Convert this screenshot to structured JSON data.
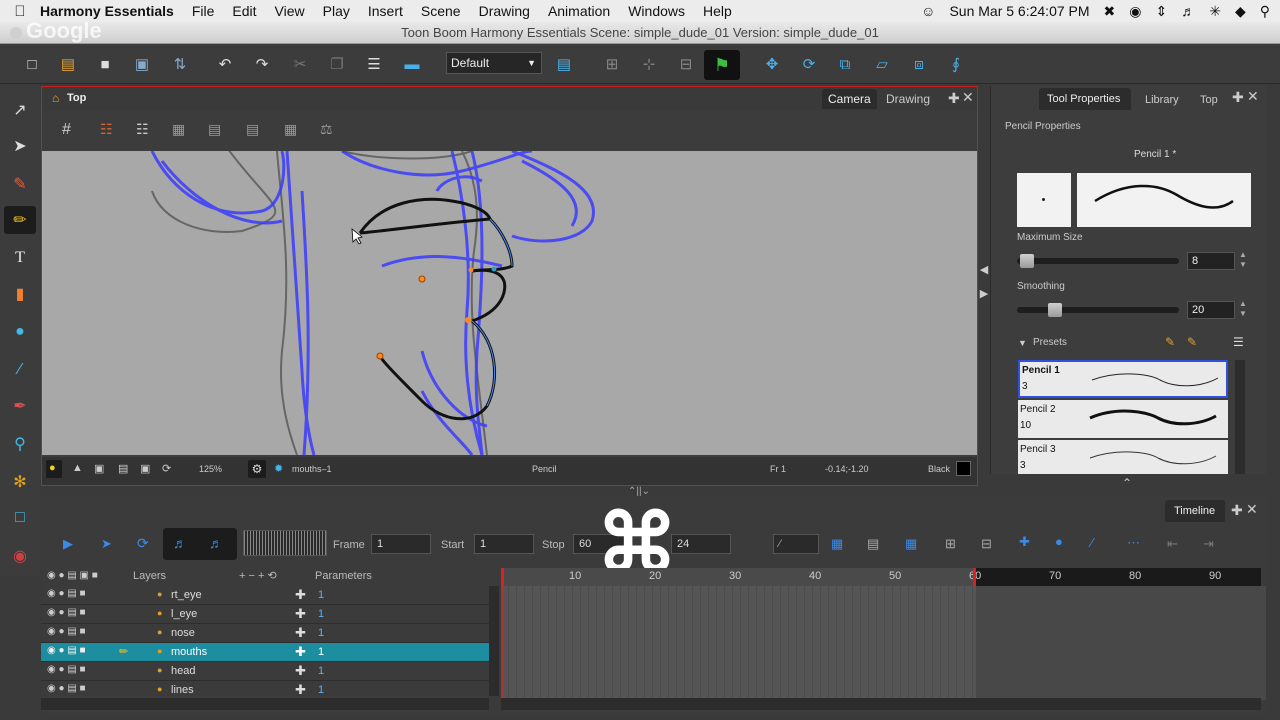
{
  "menubar": {
    "app": "Harmony Essentials",
    "items": [
      "File",
      "Edit",
      "View",
      "Play",
      "Insert",
      "Scene",
      "Drawing",
      "Animation",
      "Windows",
      "Help"
    ],
    "clock": "Sun Mar 5  6:24:07 PM"
  },
  "window": {
    "title": "Toon Boom Harmony Essentials Scene: simple_dude_01 Version: simple_dude_01",
    "overlay_logo": "Google"
  },
  "toolbar": {
    "workspace": "Default"
  },
  "camera_view": {
    "title": "Top",
    "tabs": [
      "Camera",
      "Drawing"
    ],
    "status": {
      "zoom": "125%",
      "layer": "mouths–1",
      "tool": "Pencil",
      "frame": "Fr 1",
      "coords": "-0.14;-1.20",
      "color_name": "Black"
    }
  },
  "tool_properties": {
    "tabs": [
      "Tool Properties",
      "Library",
      "Top"
    ],
    "section": "Pencil Properties",
    "preset_name": "Pencil 1 *",
    "max_size_label": "Maximum Size",
    "max_size_value": "8",
    "smoothing_label": "Smoothing",
    "smoothing_value": "20",
    "presets_label": "Presets",
    "presets": [
      {
        "name": "Pencil 1",
        "size": "3"
      },
      {
        "name": "Pencil 2",
        "size": "10"
      },
      {
        "name": "Pencil 3",
        "size": "3"
      }
    ]
  },
  "timeline": {
    "title": "Timeline",
    "frame_label": "Frame",
    "frame_value": "1",
    "start_label": "Start",
    "start_value": "1",
    "stop_label": "Stop",
    "stop_value": "60",
    "fps_value": "24",
    "layers_header": "Layers",
    "params_header": "Parameters",
    "layers": [
      {
        "name": "rt_eye",
        "value": "1"
      },
      {
        "name": "l_eye",
        "value": "1"
      },
      {
        "name": "nose",
        "value": "1"
      },
      {
        "name": "mouths",
        "value": "1"
      },
      {
        "name": "head",
        "value": "1"
      },
      {
        "name": "lines",
        "value": "1"
      }
    ],
    "ruler": [
      "10",
      "20",
      "30",
      "40",
      "50",
      "60",
      "70",
      "80",
      "90"
    ]
  },
  "overlay_cmd": "⌘",
  "colors": {
    "accent_blue": "#2b6de0",
    "selection_teal": "#1d8ea0",
    "camera_border": "#c81e1e",
    "drawing_blue": "#3b3bff"
  }
}
